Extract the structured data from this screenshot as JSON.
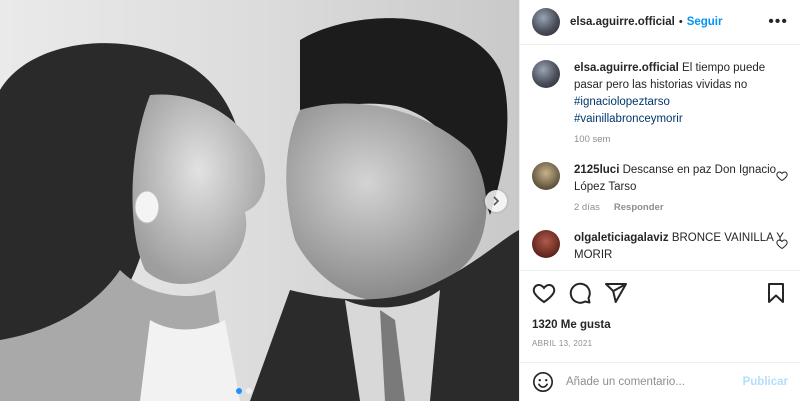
{
  "post": {
    "username": "elsa.aguirre.official",
    "separator": "•",
    "follow_label": "Seguir",
    "more_icon": "more-horizontal-icon"
  },
  "caption": {
    "username": "elsa.aguirre.official",
    "text": "El tiempo puede pasar pero las historias vividas no",
    "hashtags": [
      "#ignaciolopeztarso",
      "#vainillabronceymorir"
    ],
    "time": "100 sem"
  },
  "comments": [
    {
      "username": "2125luci",
      "text": "Descanse en paz Don Ignacio López Tarso",
      "time": "2 días",
      "reply_label": "Responder"
    },
    {
      "username": "olgaleticiagalaviz",
      "text": "BRONCE VAINILLA Y MORIR",
      "time": "",
      "reply_label": ""
    }
  ],
  "actions": {
    "icons": [
      "heart-icon",
      "comment-icon",
      "share-icon",
      "bookmark-icon"
    ],
    "likes": "1320 Me gusta",
    "date": "ABRIL 13, 2021"
  },
  "add_comment": {
    "placeholder": "Añade un comentario...",
    "publish_label": "Publicar"
  },
  "colors": {
    "accent": "#0095f6",
    "hashtag": "#00376b",
    "muted": "#8e8e8e",
    "publish_disabled": "#b2dffc"
  }
}
